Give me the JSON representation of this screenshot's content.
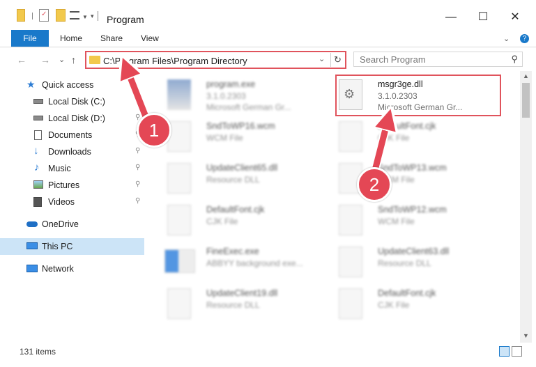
{
  "window": {
    "title": "Program",
    "minimize": "—",
    "maximize": "☐",
    "close": "✕"
  },
  "ribbon": {
    "file": "File",
    "home": "Home",
    "share": "Share",
    "view": "View",
    "expand": "⌄",
    "help": "?"
  },
  "address": {
    "path": "C:\\Program Files\\Program Directory",
    "back": "←",
    "forward": "→",
    "recent": "⌄",
    "up": "↑",
    "dropdown": "⌄",
    "refresh": "↻"
  },
  "search": {
    "placeholder": "Search Program",
    "icon": "search-icon"
  },
  "sidebar": {
    "items": [
      {
        "label": "Quick access",
        "icon": "star-icon"
      },
      {
        "label": "Local Disk (C:)",
        "icon": "drive-icon"
      },
      {
        "label": "Local Disk (D:)",
        "icon": "drive-icon"
      },
      {
        "label": "Documents",
        "icon": "documents-icon"
      },
      {
        "label": "Downloads",
        "icon": "download-icon"
      },
      {
        "label": "Music",
        "icon": "music-icon"
      },
      {
        "label": "Pictures",
        "icon": "pictures-icon"
      },
      {
        "label": "Videos",
        "icon": "videos-icon"
      },
      {
        "label": "OneDrive",
        "icon": "cloud-icon"
      },
      {
        "label": "This PC",
        "icon": "computer-icon"
      },
      {
        "label": "Network",
        "icon": "network-icon"
      }
    ]
  },
  "files": {
    "left": [
      {
        "name": "program.exe",
        "sub1": "3.1.0.2303",
        "sub2": "Microsoft German Gr..."
      },
      {
        "name": "SndToWP16.wcm",
        "sub1": "WCM File",
        "sub2": ""
      },
      {
        "name": "UpdateClient65.dll",
        "sub1": "Resource DLL",
        "sub2": ""
      },
      {
        "name": "DefaultFont.cjk",
        "sub1": "CJK File",
        "sub2": ""
      },
      {
        "name": "FineExec.exe",
        "sub1": "ABBYY background exe...",
        "sub2": ""
      },
      {
        "name": "UpdateClient19.dll",
        "sub1": "Resource DLL",
        "sub2": ""
      }
    ],
    "right": [
      {
        "name": "msgr3ge.dll",
        "sub1": "3.1.0.2303",
        "sub2": "Microsoft German Gr..."
      },
      {
        "name": "DefaultFont.cjk",
        "sub1": "CJK File",
        "sub2": ""
      },
      {
        "name": "SndToWP13.wcm",
        "sub1": "WCM File",
        "sub2": ""
      },
      {
        "name": "SndToWP12.wcm",
        "sub1": "WCM File",
        "sub2": ""
      },
      {
        "name": "UpdateClient63.dll",
        "sub1": "Resource DLL",
        "sub2": ""
      },
      {
        "name": "DefaultFont.cjk",
        "sub1": "CJK File",
        "sub2": ""
      }
    ]
  },
  "status": {
    "count": "131 items"
  },
  "annotations": {
    "step1": "1",
    "step2": "2",
    "color": "#e44755"
  }
}
